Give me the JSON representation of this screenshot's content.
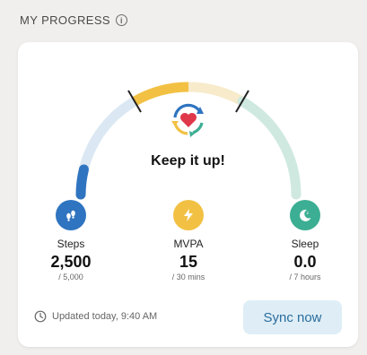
{
  "header": {
    "title": "MY PROGRESS",
    "info_icon": "info-icon"
  },
  "progress": {
    "headline": "Keep it up!",
    "center_icon": "heart-sync-icon",
    "steps_fraction": 0.5
  },
  "metrics": [
    {
      "label": "Steps",
      "value": "2,500",
      "goal": "/ 5,000",
      "icon": "footsteps-icon",
      "color": "#2f74c0"
    },
    {
      "label": "MVPA",
      "value": "15",
      "goal": "/ 30 mins",
      "icon": "lightning-icon",
      "color": "#f2c144"
    },
    {
      "label": "Sleep",
      "value": "0.0",
      "goal": "/ 7 hours",
      "icon": "moon-icon",
      "color": "#3cae93"
    }
  ],
  "footer": {
    "updated": "Updated today, 9:40 AM",
    "updated_icon": "clock-icon",
    "sync_label": "Sync now"
  },
  "colors": {
    "steps_track": "#dbe8f3",
    "steps_fill": "#2f74c0",
    "mvpa_track": "#f7ebcb",
    "mvpa_fill": "#f2c144",
    "sleep_track": "#cfe9e1",
    "divider": "#222222",
    "sync_bg": "#dfeef6",
    "sync_text": "#2a6d9e"
  }
}
